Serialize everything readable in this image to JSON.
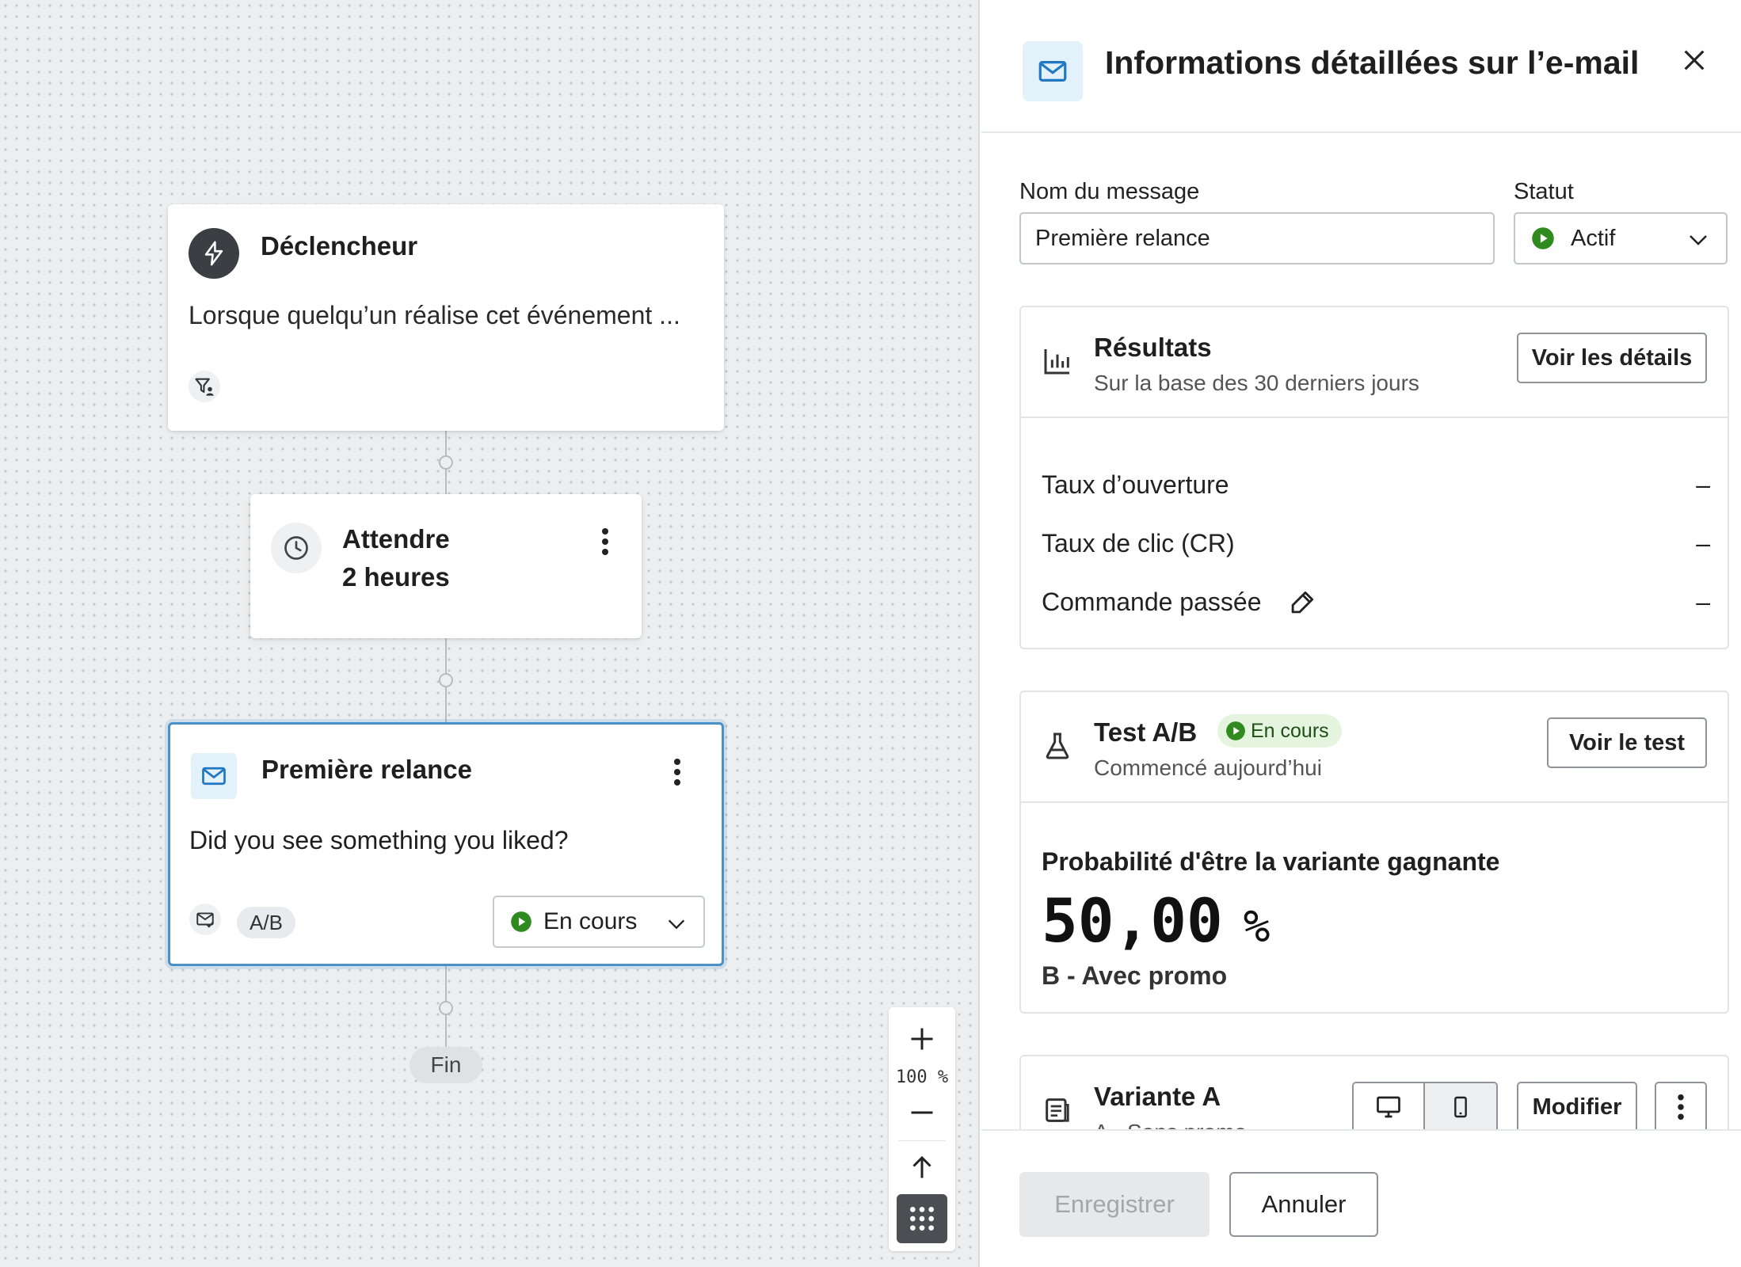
{
  "canvas": {
    "trigger": {
      "title": "Déclencheur",
      "description": "Lorsque quelqu’un réalise cet événement ...",
      "icon": "lightning-icon",
      "filter_icon": "filter-person-icon"
    },
    "wait": {
      "title": "Attendre",
      "duration": "2 heures",
      "icon": "clock-icon"
    },
    "email": {
      "title": "Première relance",
      "description": "Did you see something you liked?",
      "ab_label": "A/B",
      "status_label": "En cours",
      "icon": "envelope-icon"
    },
    "end_label": "Fin",
    "zoom": {
      "level": "100 %"
    }
  },
  "panel": {
    "title": "Informations détaillées sur l’e-mail",
    "message_name_label": "Nom du message",
    "message_name_value": "Première relance",
    "status_label": "Statut",
    "status_value": "Actif",
    "results": {
      "title": "Résultats",
      "subtitle": "Sur la base des 30 derniers jours",
      "button": "Voir les détails",
      "metrics": [
        {
          "label": "Taux d’ouverture",
          "value": "–"
        },
        {
          "label": "Taux de clic (CR)",
          "value": "–"
        },
        {
          "label": "Commande passée",
          "value": "–"
        }
      ]
    },
    "ab_test": {
      "title": "Test A/B",
      "badge": "En cours",
      "subtitle": "Commencé aujourd’hui",
      "button": "Voir le test",
      "probability_label": "Probabilité d'être la variante gagnante",
      "probability_value": "50,00",
      "probability_unit": "%",
      "variant_name": "B - Avec promo"
    },
    "variant_a": {
      "title": "Variante A",
      "subtitle": "A - Sans promo",
      "modify_button": "Modifier"
    },
    "footer": {
      "save": "Enregistrer",
      "cancel": "Annuler"
    }
  },
  "colors": {
    "accent_blue": "#4a90c9",
    "status_green": "#2f8a1f",
    "badge_green_bg": "#e4f4de",
    "icon_bg_blue": "#e3f1fb"
  }
}
